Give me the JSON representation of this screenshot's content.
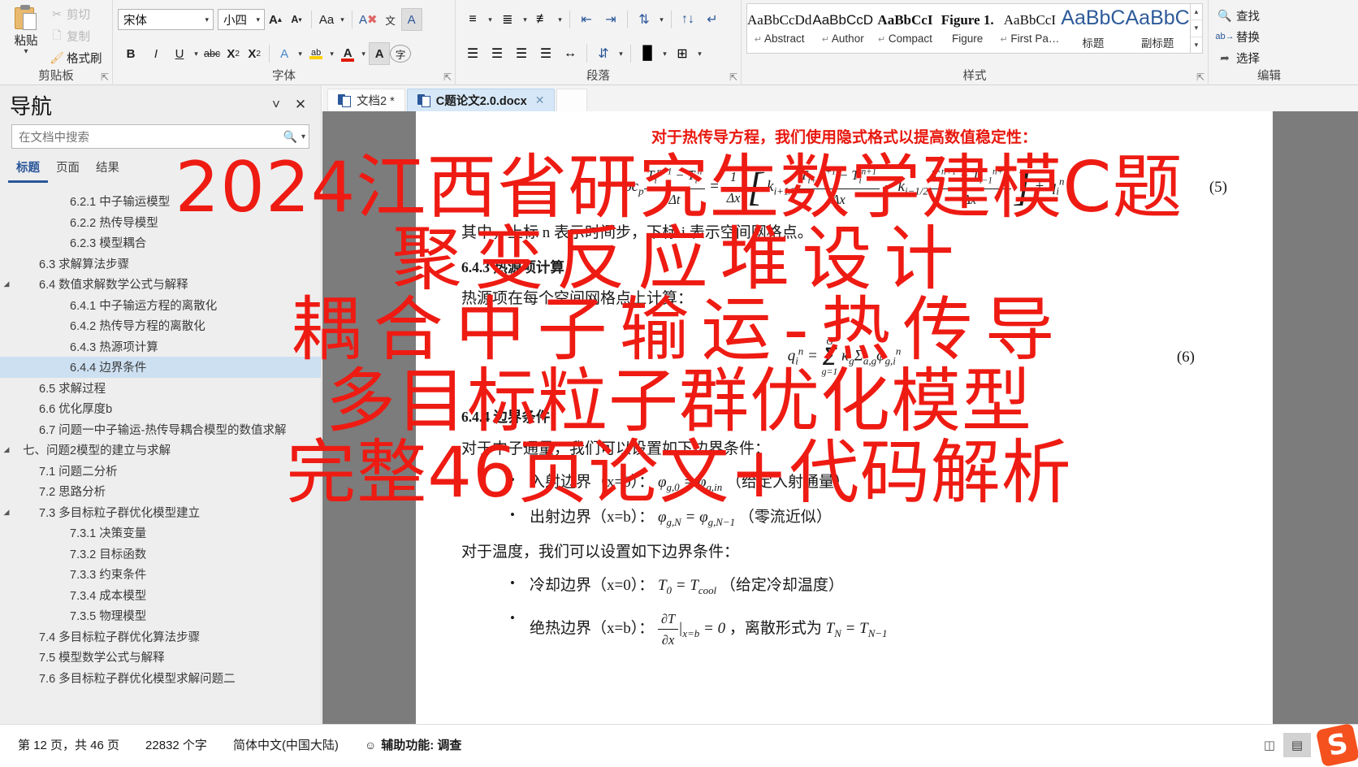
{
  "ribbon": {
    "groups": [
      {
        "name": "clipboard",
        "label": "剪贴板"
      },
      {
        "name": "font",
        "label": "字体"
      },
      {
        "name": "paragraph",
        "label": "段落"
      },
      {
        "name": "styles",
        "label": "样式"
      },
      {
        "name": "editing",
        "label": "编辑"
      }
    ],
    "clipboard": {
      "paste_label": "粘贴",
      "cut_label": "剪切",
      "copy_label": "复制",
      "format_painter_label": "格式刷",
      "group_label": "剪贴板"
    },
    "font": {
      "font_name": "宋体",
      "font_size": "小四",
      "group_label": "字体",
      "grow_font": "A",
      "shrink_font": "A",
      "change_case": "Aa",
      "clear_formatting": "A",
      "phonetic_guide": "文",
      "char_border": "A",
      "bold": "B",
      "italic": "I",
      "underline": "U",
      "strikethrough": "abc",
      "subscript": "X",
      "superscript": "X",
      "text_effects": "A",
      "highlight": "ab",
      "font_color": "A",
      "shading": "A",
      "enclose_char": "字"
    },
    "paragraph": {
      "group_label": "段落",
      "bullets": "bullets-icon",
      "numbering": "numbering-icon",
      "multilevel": "multilevel-list-icon",
      "decrease_indent": "decrease-indent-icon",
      "increase_indent": "increase-indent-icon",
      "sort": "sort-icon",
      "show_marks": "show-formatting-marks-icon",
      "align_left": "align-left-icon",
      "align_center": "align-center-icon",
      "align_right": "align-right-icon",
      "justify": "justify-icon",
      "distribute": "distribute-icon",
      "line_spacing": "line-spacing-icon",
      "shading_fill": "shading-icon",
      "borders": "borders-icon"
    },
    "styles": {
      "group_label": "样式",
      "items": [
        {
          "preview": "AaBbCcDd",
          "name": "Abstract",
          "pilcrow": true,
          "variant": "serif"
        },
        {
          "preview": "AaBbCcD",
          "name": "Author",
          "pilcrow": true,
          "variant": "sans"
        },
        {
          "preview": "AaBbCcI",
          "name": "Compact",
          "pilcrow": true,
          "variant": "serif-bold"
        },
        {
          "preview": "Figure 1.",
          "name": "Figure",
          "pilcrow": false,
          "variant": "serif-bold"
        },
        {
          "preview": "AaBbCcI",
          "name": "First Pa…",
          "pilcrow": true,
          "variant": "serif"
        },
        {
          "preview": "AaBbC",
          "name": "标题",
          "pilcrow": false,
          "variant": "big"
        },
        {
          "preview": "AaBbC",
          "name": "副标题",
          "pilcrow": false,
          "variant": "big"
        }
      ]
    },
    "editing": {
      "group_label": "编辑",
      "find": "查找",
      "replace": "替换",
      "select": "选择",
      "replace_icon_text": "ab"
    }
  },
  "navigation": {
    "title": "导航",
    "collapse_label": "chevron-down-icon",
    "close_label": "close-icon",
    "search": {
      "placeholder": "在文档中搜索",
      "value": ""
    },
    "tabs": [
      {
        "label": "标题",
        "active": true
      },
      {
        "label": "页面",
        "active": false
      },
      {
        "label": "结果",
        "active": false
      }
    ],
    "items": [
      {
        "label": "6.2.1 中子输运模型",
        "level": 3,
        "expander": "",
        "selected": false
      },
      {
        "label": "6.2.2 热传导模型",
        "level": 3,
        "expander": "",
        "selected": false
      },
      {
        "label": "6.2.3 模型耦合",
        "level": 3,
        "expander": "",
        "selected": false
      },
      {
        "label": "6.3 求解算法步骤",
        "level": 2,
        "expander": "",
        "selected": false
      },
      {
        "label": "6.4 数值求解数学公式与解释",
        "level": 2,
        "expander": "▲",
        "selected": false
      },
      {
        "label": "6.4.1 中子输运方程的离散化",
        "level": 3,
        "expander": "",
        "selected": false
      },
      {
        "label": "6.4.2 热传导方程的离散化",
        "level": 3,
        "expander": "",
        "selected": false
      },
      {
        "label": "6.4.3 热源项计算",
        "level": 3,
        "expander": "",
        "selected": false
      },
      {
        "label": "6.4.4 边界条件",
        "level": 3,
        "expander": "",
        "selected": true
      },
      {
        "label": "6.5 求解过程",
        "level": 2,
        "expander": "",
        "selected": false
      },
      {
        "label": "6.6 优化厚度b",
        "level": 2,
        "expander": "",
        "selected": false
      },
      {
        "label": "6.7 问题一中子输运-热传导耦合模型的数值求解",
        "level": 2,
        "expander": "",
        "selected": false
      },
      {
        "label": "七、问题2模型的建立与求解",
        "level": 1,
        "expander": "▲",
        "selected": false
      },
      {
        "label": "7.1 问题二分析",
        "level": 2,
        "expander": "",
        "selected": false
      },
      {
        "label": "7.2 思路分析",
        "level": 2,
        "expander": "",
        "selected": false
      },
      {
        "label": "7.3 多目标粒子群优化模型建立",
        "level": 2,
        "expander": "▲",
        "selected": false
      },
      {
        "label": "7.3.1 决策变量",
        "level": 3,
        "expander": "",
        "selected": false
      },
      {
        "label": "7.3.2 目标函数",
        "level": 3,
        "expander": "",
        "selected": false
      },
      {
        "label": "7.3.3 约束条件",
        "level": 3,
        "expander": "",
        "selected": false
      },
      {
        "label": "7.3.4 成本模型",
        "level": 3,
        "expander": "",
        "selected": false
      },
      {
        "label": "7.3.5 物理模型",
        "level": 3,
        "expander": "",
        "selected": false
      },
      {
        "label": "7.4 多目标粒子群优化算法步骤",
        "level": 2,
        "expander": "",
        "selected": false
      },
      {
        "label": "7.5 模型数学公式与解释",
        "level": 2,
        "expander": "",
        "selected": false
      },
      {
        "label": "7.6 多目标粒子群优化模型求解问题二",
        "level": 2,
        "expander": "",
        "selected": false
      }
    ]
  },
  "document_tabs": [
    {
      "label": "文档2 *",
      "active": false,
      "closable": false
    },
    {
      "label": "C题论文2.0.docx",
      "active": true,
      "closable": true
    }
  ],
  "document": {
    "intro_red": "对于热传导方程，我们使用隐式格式以提高数值稳定性：",
    "eq5_number": "(5)",
    "note_line": "其中，上标 n 表示时间步，下标 i 表示空间网格点。",
    "heading_643": "6.4.3 热源项计算",
    "para_heat_source": "热源项在每个空间网格点上计算：",
    "eq6_number": "(6)",
    "heading_644": "6.4.4 边界条件",
    "para_flux_bc": "对于中子通量，我们可以设置如下边界条件：",
    "bullets_flux": [
      {
        "text": "入射边界（x=0）：",
        "note": "（给定入射通量）"
      },
      {
        "text": "出射边界（x=b）：",
        "note": "（零流近似）"
      }
    ],
    "para_temp_bc": "对于温度，我们可以设置如下边界条件：",
    "bullets_temp": [
      {
        "text": "冷却边界（x=0）：",
        "note": "（给定冷却温度）"
      },
      {
        "text": "绝热边界（x=b）：",
        "note": "，离散形式为"
      }
    ]
  },
  "watermark": {
    "color": "#ee1b13",
    "lines": [
      "2024江西省研究生数学建模C题",
      "聚变反应堆设计",
      "耦合中子输运-热传导",
      "多目标粒子群优化模型",
      "完整46页论文+代码解析"
    ]
  },
  "statusbar": {
    "page_info": "第 12 页，共 46 页",
    "word_count": "22832 个字",
    "language": "简体中文(中国大陆)",
    "accessibility": "辅助功能: 调查",
    "view_read": "read-mode-icon",
    "view_print": "print-layout-icon",
    "ime_logo": "S"
  }
}
